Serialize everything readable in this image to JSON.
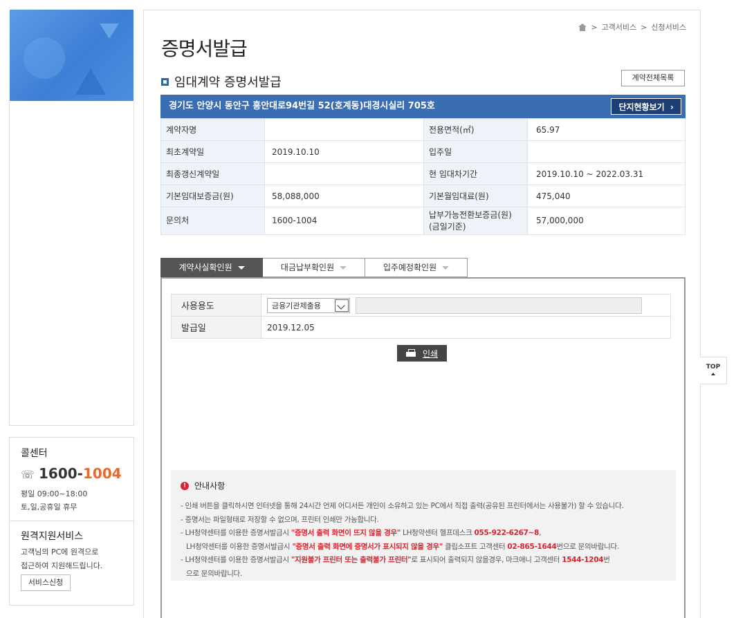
{
  "breadcrumb": {
    "items": [
      "고객서비스",
      "신청서비스"
    ]
  },
  "page": {
    "title": "증명서발급",
    "subtitle": "임대계약 증명서발급"
  },
  "buttons": {
    "contract_list": "계약전체목록",
    "complex_status": "단지현황보기",
    "print": "인쇄",
    "top": "TOP"
  },
  "address": "경기도 안양시 동안구 흥안대로94번길 52(호계동)대경시실리 705호",
  "info": [
    {
      "l1": "계약자명",
      "v1": "",
      "l2": "전용면적(㎡)",
      "v2": "65.97"
    },
    {
      "l1": "최초계약일",
      "v1": "2019.10.10",
      "l2": "입주일",
      "v2": ""
    },
    {
      "l1": "최종갱신계약일",
      "v1": "",
      "l2": "현 임대차기간",
      "v2": "2019.10.10 ~ 2022.03.31"
    },
    {
      "l1": "기본임대보증금(원)",
      "v1": "58,088,000",
      "l2": "기본월임대료(원)",
      "v2": "475,040"
    },
    {
      "l1": "문의처",
      "v1": "1600-1004",
      "l2": "납부가능전환보증금(원)",
      "l2b": "(금일기준)",
      "v2": "57,000,000"
    }
  ],
  "tabs": [
    "계약사실확인원",
    "대금납부확인원",
    "입주예정확인원"
  ],
  "form": {
    "usage_label": "사용용도",
    "usage_value": "금융기관제출용",
    "issue_label": "발급일",
    "issue_value": "2019.12.05"
  },
  "notice": {
    "title": "안내사항",
    "line1": "- 인쇄 버튼을 클릭하시면 인터넷을 통해 24시간 언제 어디서든 개인이 소유하고 있는 PC에서 직접 출력(공유된 프린터에서는 사용불가) 할 수 있습니다.",
    "line2": "- 증명서는 파일형태로 저장할 수 없으며, 프린터 인쇄만 가능합니다.",
    "line3a": "- LH청약센터를 이용한 증명서발급시 ",
    "line3red": "\"증명서 출력 화면이 뜨지 않을 경우\"",
    "line3b": " LH청약센터 헬프데스크 ",
    "line3phone": "055-922-6267~8",
    "line3c": ",",
    "line4a": "LH청약센터를 이용한 증명서발급시 ",
    "line4red": "\"증명서 출력 화면에 증명서가 표시되지 않을 경우\"",
    "line4b": " 클립소프트 고객센터 ",
    "line4phone": "02-865-1644",
    "line4c": "번으로 문의바랍니다.",
    "line5a": "- LH청약센터를 이용한 증명서발급시 ",
    "line5red": "\"지원불가 프린터 또는 출력불가 프린터\"",
    "line5b": "로 표시되어 출력되지 않을경우,  마크애니 고객센터 ",
    "line5phone": "1544-1204",
    "line5c": "번",
    "line6": "으로 문의바랍니다."
  },
  "sidebar": {
    "callcenter_title": "콜센터",
    "phone_main": "1600-",
    "phone_accent": "1004",
    "hours1": "평일 09:00~18:00",
    "hours2": "토,일,공휴일 휴무",
    "remote_title": "원격지원서비스",
    "remote_desc1": "고객님의 PC에 원격으로",
    "remote_desc2": "접근하여 지원해드립니다.",
    "remote_btn": "서비스신청"
  },
  "colors": {
    "accent": "#3b6db3",
    "orange": "#f26522",
    "red": "#d9232d"
  }
}
